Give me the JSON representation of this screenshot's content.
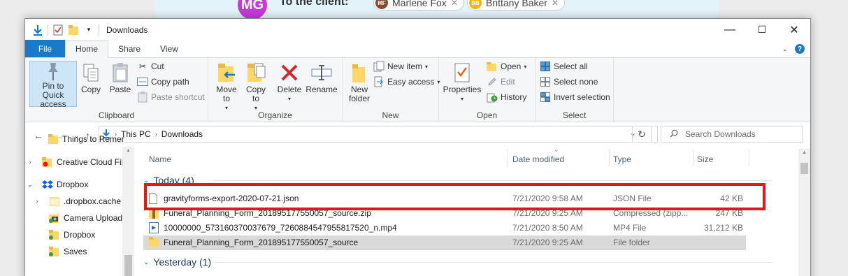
{
  "background": {
    "avatar_initials": "MG",
    "client_label": "To the client:",
    "chips": [
      {
        "initials": "MF",
        "name": "Marlene Fox",
        "color": "#8a4b2a"
      },
      {
        "initials": "BB",
        "name": "Brittany Baker",
        "color": "#f2b705"
      }
    ]
  },
  "window": {
    "title": "Downloads",
    "controls": {
      "minimize": "—",
      "maximize": "☐",
      "close": "✕"
    }
  },
  "tabs": [
    {
      "label": "File"
    },
    {
      "label": "Home"
    },
    {
      "label": "Share"
    },
    {
      "label": "View"
    }
  ],
  "ribbon": {
    "clipboard": {
      "label": "Clipboard",
      "pin": "Pin to Quick access",
      "copy": "Copy",
      "paste": "Paste",
      "cut": "Cut",
      "copy_path": "Copy path",
      "paste_shortcut": "Paste shortcut"
    },
    "organize": {
      "label": "Organize",
      "move_to": "Move to",
      "copy_to": "Copy to",
      "delete": "Delete",
      "rename": "Rename"
    },
    "new": {
      "label": "New",
      "new_folder": "New folder",
      "new_item": "New item",
      "easy_access": "Easy access"
    },
    "open": {
      "label": "Open",
      "properties": "Properties",
      "open": "Open",
      "edit": "Edit",
      "history": "History"
    },
    "select": {
      "label": "Select",
      "select_all": "Select all",
      "select_none": "Select none",
      "invert": "Invert selection"
    }
  },
  "address": {
    "crumbs": [
      "This PC",
      "Downloads"
    ],
    "search_placeholder": "Search Downloads"
  },
  "nav_pane": [
    {
      "label": "Things to Remer",
      "icon": "folder-icon",
      "chevron": ""
    },
    {
      "label": "Creative Cloud Fil",
      "icon": "creative-cloud-folder-icon",
      "chevron": ">"
    },
    {
      "label": "Dropbox",
      "icon": "dropbox-icon",
      "chevron": "v"
    },
    {
      "label": ".dropbox.cache",
      "icon": "folder-icon",
      "chevron": ">"
    },
    {
      "label": "Camera Uploads",
      "icon": "camera-folder-icon",
      "chevron": ""
    },
    {
      "label": "Dropbox",
      "icon": "synced-folder-icon",
      "chevron": ""
    },
    {
      "label": "Saves",
      "icon": "synced-folder-icon",
      "chevron": ""
    }
  ],
  "columns": {
    "name": "Name",
    "date_modified": "Date modified",
    "type": "Type",
    "size": "Size"
  },
  "groups": [
    {
      "label": "Today (4)",
      "files": [
        {
          "name": "gravityforms-export-2020-07-21.json",
          "date": "7/21/2020 9:58 AM",
          "type": "JSON File",
          "size": "42 KB",
          "icon": "document-icon"
        },
        {
          "name": "Funeral_Planning_Form_201895177550057_source.zip",
          "date": "7/21/2020 9:25 AM",
          "type": "Compressed (zipp...",
          "size": "247 KB",
          "icon": "zip-icon"
        },
        {
          "name": "10000000_573160370037679_7260884547955817520_n.mp4",
          "date": "7/21/2020 8:50 AM",
          "type": "MP4 File",
          "size": "31,212 KB",
          "icon": "video-icon"
        },
        {
          "name": "Funeral_Planning_Form_201895177550057_source",
          "date": "7/21/2020 9:25 AM",
          "type": "File folder",
          "size": "",
          "icon": "folder-icon"
        }
      ]
    },
    {
      "label": "Yesterday (1)",
      "files": []
    }
  ],
  "colors": {
    "accent": "#1979ca",
    "highlight": "#e3161d",
    "selected_row": "#d9d9d9"
  }
}
